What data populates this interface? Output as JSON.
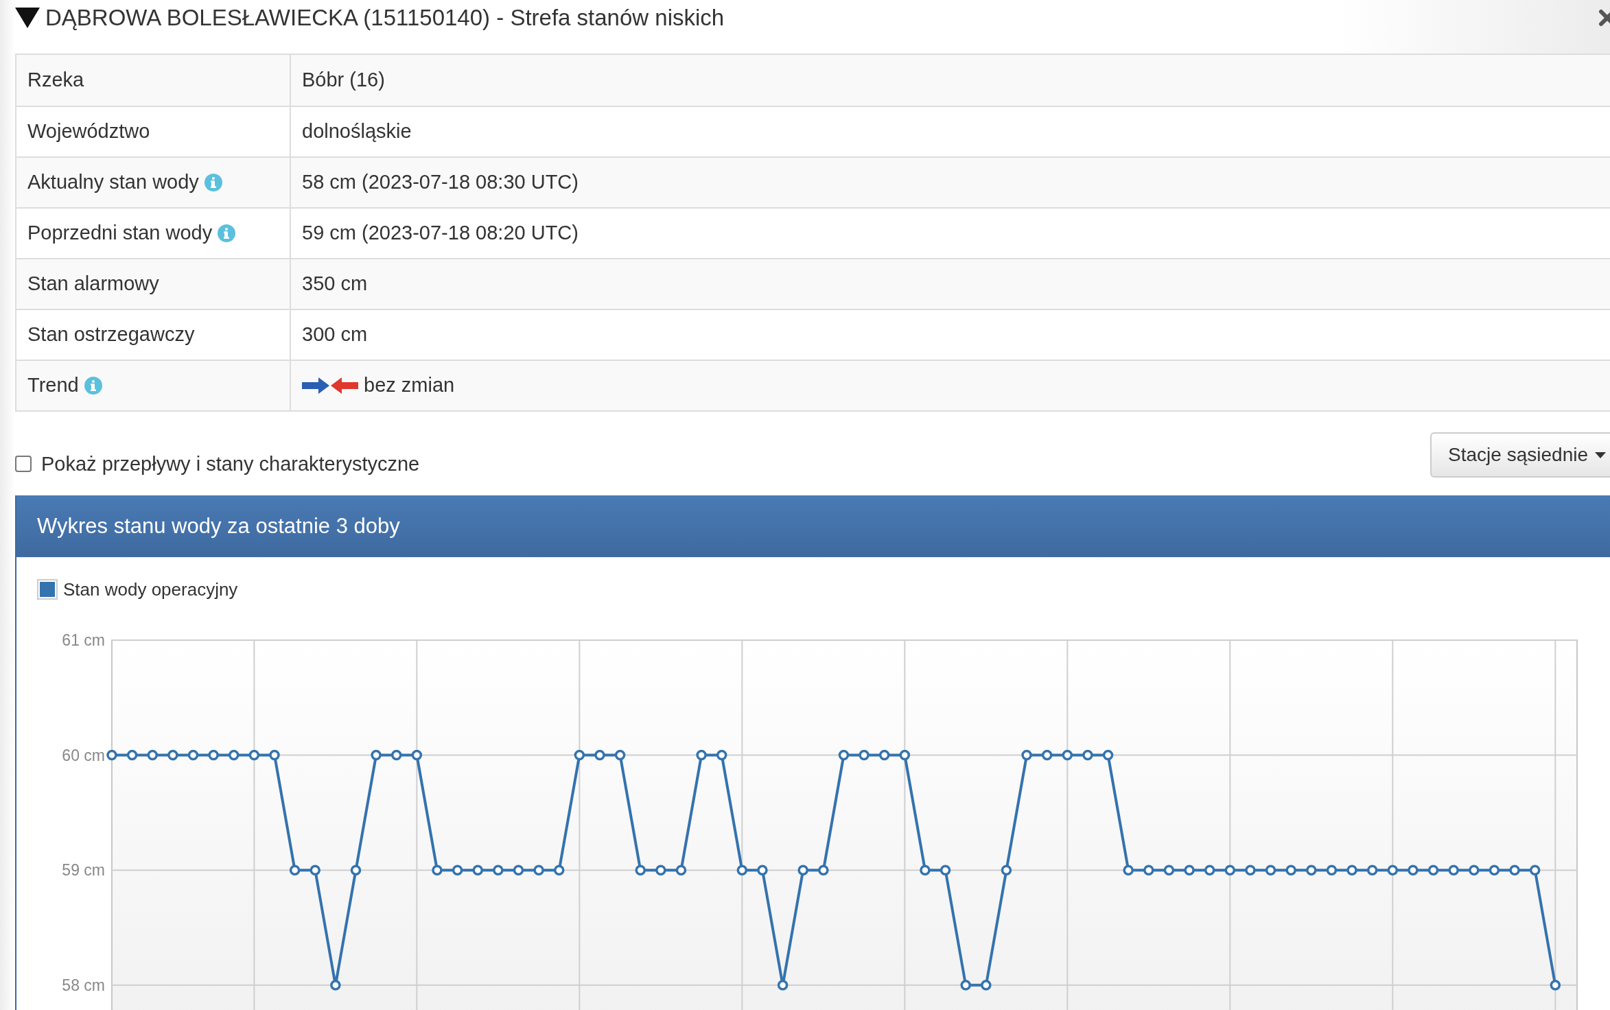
{
  "modal": {
    "title": "DĄBROWA BOLESŁAWIECKA (151150140) - Strefa stanów niskich"
  },
  "info_table": {
    "rows": [
      {
        "kind": "text",
        "label": "Rzeka",
        "info": false,
        "value": "Bóbr (16)"
      },
      {
        "kind": "text",
        "label": "Województwo",
        "info": false,
        "value": "dolnośląskie"
      },
      {
        "kind": "text",
        "label": "Aktualny stan wody",
        "info": true,
        "value": "58 cm (2023-07-18 08:30 UTC)"
      },
      {
        "kind": "text",
        "label": "Poprzedni stan wody",
        "info": true,
        "value": "59 cm (2023-07-18 08:20 UTC)"
      },
      {
        "kind": "text",
        "label": "Stan alarmowy",
        "info": false,
        "value": "350 cm"
      },
      {
        "kind": "text",
        "label": "Stan ostrzegawczy",
        "info": false,
        "value": "300 cm"
      },
      {
        "kind": "trend",
        "label": "Trend",
        "info": true,
        "value": "bez zmian"
      }
    ]
  },
  "show_characteristic": {
    "label": "Pokaż przepływy i stany charakterystyczne",
    "checked": false
  },
  "neighbor_button": {
    "label": "Stacje sąsiednie"
  },
  "chart_panel": {
    "title": "Wykres stanu wody za ostatnie 3 doby",
    "chart_data": {
      "type": "line",
      "ylim": [
        57.76,
        61
      ],
      "grid": true,
      "yticks": [
        {
          "value": 58,
          "label": "58 cm"
        },
        {
          "value": 59,
          "label": "59 cm"
        },
        {
          "value": 60,
          "label": "60 cm"
        },
        {
          "value": 61,
          "label": "61 cm"
        }
      ],
      "series": [
        {
          "name": "Stan wody operacyjny",
          "color": "#3473ad",
          "marker": "circle",
          "values": [
            60,
            60,
            60,
            60,
            60,
            60,
            60,
            60,
            60,
            59,
            59,
            58,
            59,
            60,
            60,
            60,
            59,
            59,
            59,
            59,
            59,
            59,
            59,
            60,
            60,
            60,
            59,
            59,
            59,
            60,
            60,
            59,
            59,
            58,
            59,
            59,
            60,
            60,
            60,
            60,
            59,
            59,
            58,
            58,
            59,
            60,
            60,
            60,
            60,
            60,
            59,
            59,
            59,
            59,
            59,
            59,
            59,
            59,
            59,
            59,
            59,
            59,
            59,
            59,
            59,
            59,
            59,
            59,
            59,
            59,
            59,
            58
          ]
        }
      ]
    }
  }
}
